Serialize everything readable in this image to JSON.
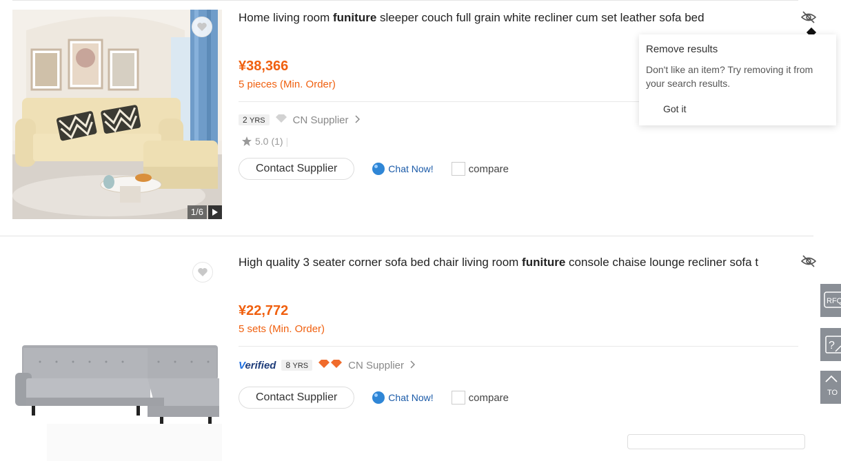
{
  "products": [
    {
      "title_pre": "Home living room ",
      "title_bold": "funiture",
      "title_post": " sleeper couch full grain white recliner cum set leather sofa bed",
      "price": "¥38,366",
      "min_order": "5 pieces (Min. Order)",
      "years": "2",
      "years_unit": "YRS",
      "supplier": "CN Supplier",
      "rating": "5.0",
      "rating_count": "(1)",
      "image_counter": "1/6",
      "contact_label": "Contact Supplier",
      "chat_label": "Chat Now!",
      "compare_label": "compare"
    },
    {
      "title_pre": "High quality 3 seater corner sofa bed chair living room ",
      "title_bold": "funiture",
      "title_post": " console chaise lounge recliner sofa t",
      "price": "¥22,772",
      "min_order": "5 sets (Min. Order)",
      "verified_a": "V",
      "verified_b": "erified",
      "years": "8",
      "years_unit": "YRS",
      "supplier": "CN Supplier",
      "contact_label": "Contact Supplier",
      "chat_label": "Chat Now!",
      "compare_label": "compare"
    }
  ],
  "popover": {
    "title": "Remove results",
    "body": "Don't like an item? Try removing it from your search results.",
    "button": "Got it"
  },
  "side_tools": {
    "rfq": "RFQ",
    "top": "TO"
  },
  "colors": {
    "price": "#f0600f",
    "chat": "#1a5aa8",
    "side_tool": "#8a8f96"
  }
}
